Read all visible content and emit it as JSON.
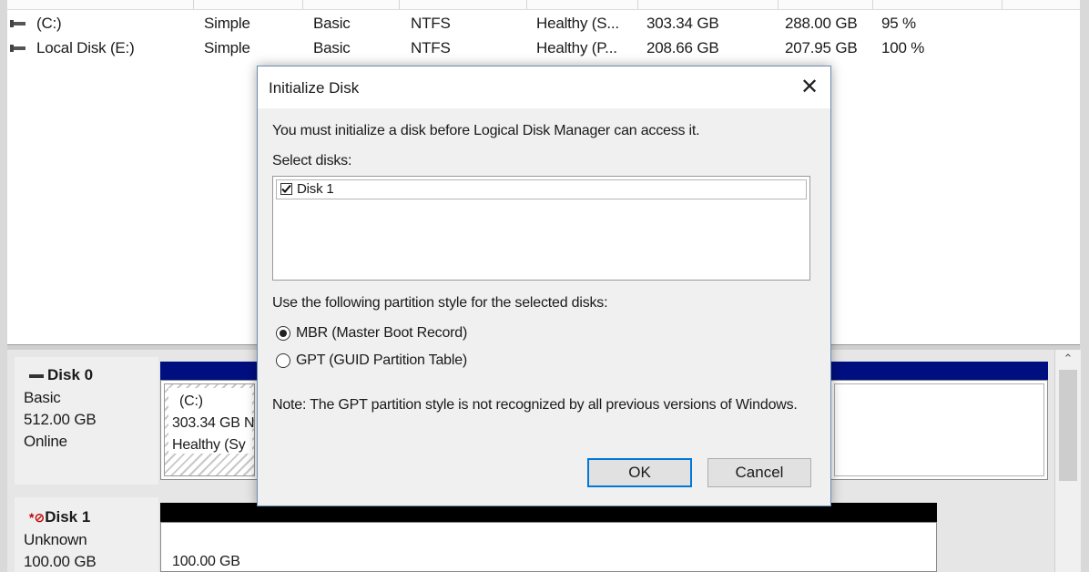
{
  "volumes": [
    {
      "volume": "(C:)",
      "layout": "Simple",
      "type": "Basic",
      "file_system": "NTFS",
      "status": "Healthy (S...",
      "capacity": "303.34 GB",
      "free_space": "288.00 GB",
      "percent_free": "95 %"
    },
    {
      "volume": "Local Disk (E:)",
      "layout": "Simple",
      "type": "Basic",
      "file_system": "NTFS",
      "status": "Healthy (P...",
      "capacity": "208.66 GB",
      "free_space": "207.95 GB",
      "percent_free": "100 %"
    }
  ],
  "disks": [
    {
      "name": "Disk 0",
      "kind": "Basic",
      "size": "512.00 GB",
      "state": "Online",
      "partition": {
        "label": "(C:)",
        "size": "303.34 GB N",
        "status": "Healthy (Sy"
      }
    },
    {
      "name": "Disk 1",
      "kind": "Unknown",
      "size": "100.00 GB",
      "unallocated": "100.00 GB"
    }
  ],
  "dialog": {
    "title": "Initialize Disk",
    "intro": "You must initialize a disk before Logical Disk Manager can access it.",
    "select_label": "Select disks:",
    "disk_items": [
      {
        "label": "Disk 1",
        "checked": true
      }
    ],
    "style_label": "Use the following partition style for the selected disks:",
    "options": [
      {
        "label": "MBR (Master Boot Record)",
        "selected": true
      },
      {
        "label": "GPT (GUID Partition Table)",
        "selected": false
      }
    ],
    "note": "Note: The GPT partition style is not recognized by all previous versions of Windows.",
    "ok_label": "OK",
    "cancel_label": "Cancel"
  },
  "icons": {
    "close": "close-icon",
    "checkmark": "checkmark-icon",
    "scroll_up": "chevron-up-icon"
  },
  "colors": {
    "disk0_bar": "#000f80",
    "disk1_bar": "#000000",
    "ok_border": "#0078d7",
    "offline_marker": "#c00000"
  }
}
